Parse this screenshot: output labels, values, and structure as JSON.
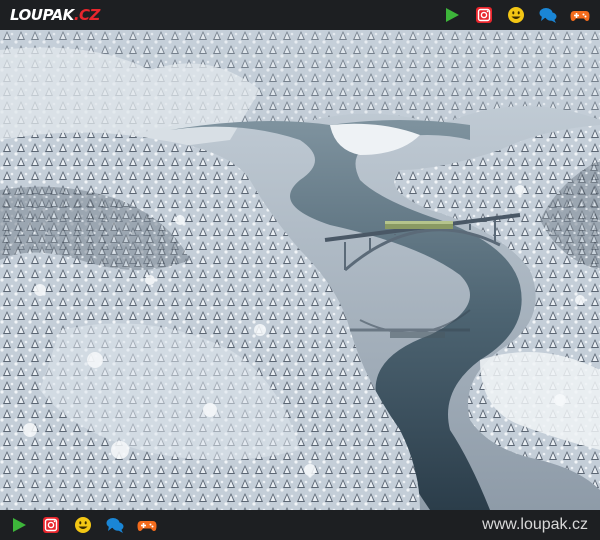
{
  "logo": {
    "main": "LOUPAK",
    "suffix": ".CZ"
  },
  "top_icons": [
    "play-icon",
    "instagram-icon",
    "smiley-icon",
    "chat-bubbles-icon",
    "gamepad-icon"
  ],
  "bottom_icons": [
    "play-icon",
    "instagram-icon",
    "smiley-icon",
    "chat-bubbles-icon",
    "gamepad-icon"
  ],
  "footer": {
    "url": "www.loupak.cz"
  },
  "colors": {
    "bar": "#1d1f22",
    "logo_red": "#e8262d",
    "play": "#3db53a",
    "instagram": "#e8262d",
    "smiley": "#f3c614",
    "chat": "#1a86d6",
    "gamepad": "#f36b1c"
  }
}
